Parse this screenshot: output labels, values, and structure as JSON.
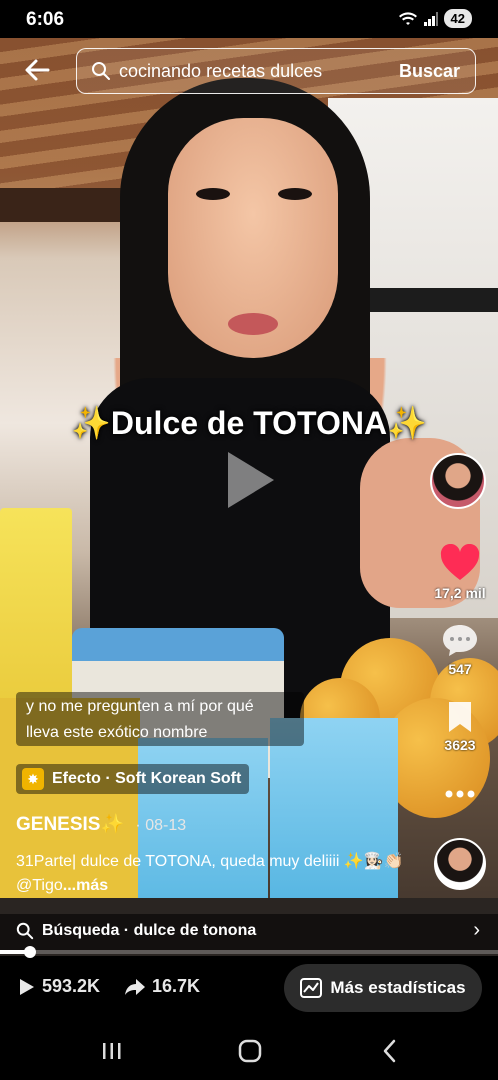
{
  "status_bar": {
    "time": "6:06",
    "battery": "42"
  },
  "search": {
    "query": "cocinando recetas dulces",
    "button_label": "Buscar"
  },
  "video": {
    "overlay_title": "✨Dulce de TOTONA✨"
  },
  "actions": {
    "likes": "17,2 mil",
    "comments": "547",
    "bookmarks": "3623"
  },
  "caption": {
    "line1": "y no me pregunten a mí por qué",
    "line2": "lleva este exótico nombre"
  },
  "effect": {
    "label": "Efecto · Soft Korean Soft"
  },
  "author": {
    "name": "GENESIS✨",
    "date": "· 08-13"
  },
  "description": {
    "text": "31Parte| dulce de TOTONA, queda muy deliiii ✨👩🏻‍🍳👏🏻 @Tigo",
    "more": "...más"
  },
  "search_suggestion": {
    "label": "Búsqueda · dulce de tonona"
  },
  "progress": {
    "fraction": 0.06
  },
  "stats": {
    "views": "593.2K",
    "shares": "16.7K",
    "more_stats_label": "Más estadísticas"
  },
  "colors": {
    "like_red": "#fe2c55",
    "effect_yellow": "#f0b400"
  }
}
